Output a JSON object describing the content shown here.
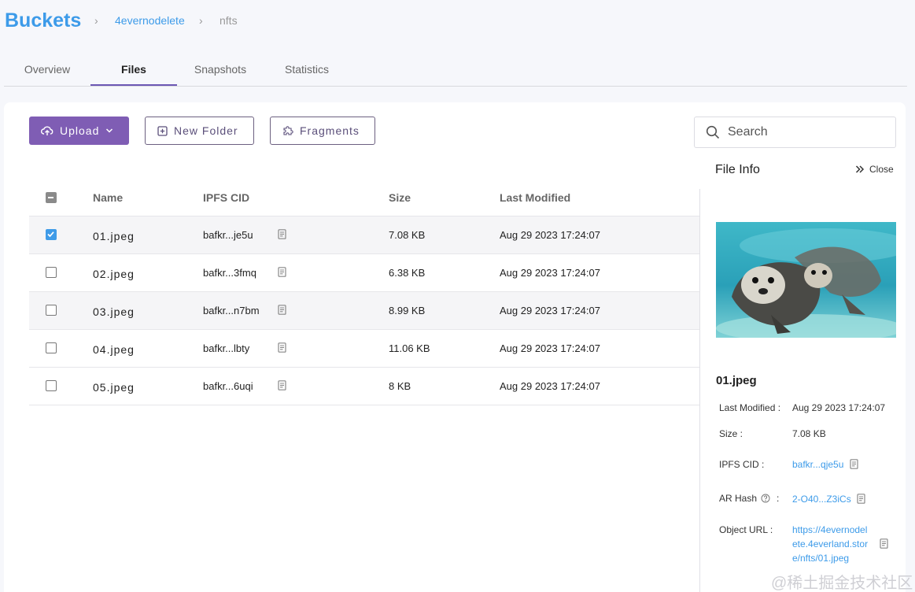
{
  "breadcrumb": {
    "title": "Buckets",
    "bucket": "4evernodelete",
    "folder": "nfts"
  },
  "tabs": [
    {
      "label": "Overview"
    },
    {
      "label": "Files"
    },
    {
      "label": "Snapshots"
    },
    {
      "label": "Statistics"
    }
  ],
  "toolbar": {
    "upload_label": "Upload",
    "new_folder_label": "New Folder",
    "fragments_label": "Fragments",
    "search_placeholder": "Search"
  },
  "table": {
    "headers": {
      "name": "Name",
      "cid": "IPFS CID",
      "size": "Size",
      "modified": "Last Modified"
    },
    "rows": [
      {
        "name": "01.jpeg",
        "cid": "bafkr...je5u",
        "size": "7.08 KB",
        "modified": "Aug 29 2023 17:24:07",
        "checked": true
      },
      {
        "name": "02.jpeg",
        "cid": "bafkr...3fmq",
        "size": "6.38 KB",
        "modified": "Aug 29 2023 17:24:07",
        "checked": false
      },
      {
        "name": "03.jpeg",
        "cid": "bafkr...n7bm",
        "size": "8.99 KB",
        "modified": "Aug 29 2023 17:24:07",
        "checked": false
      },
      {
        "name": "04.jpeg",
        "cid": "bafkr...lbty",
        "size": "11.06 KB",
        "modified": "Aug 29 2023 17:24:07",
        "checked": false
      },
      {
        "name": "05.jpeg",
        "cid": "bafkr...6uqi",
        "size": "8 KB",
        "modified": "Aug 29 2023 17:24:07",
        "checked": false
      }
    ]
  },
  "file_info": {
    "title": "File Info",
    "close_label": "Close",
    "name": "01.jpeg",
    "last_modified_label": "Last Modified :",
    "last_modified": "Aug 29 2023 17:24:07",
    "size_label": "Size :",
    "size": "7.08 KB",
    "cid_label": "IPFS CID :",
    "cid": "bafkr...qje5u",
    "ar_hash_label": "AR Hash",
    "ar_hash_colon": ":",
    "ar_hash": "2-O40...Z3iCs",
    "object_url_label": "Object URL :",
    "object_url_lines": [
      "https://4evernodel",
      "ete.4everland.stor",
      "e/nfts/01.jpeg"
    ]
  },
  "watermark": "@稀土掘金技术社区",
  "colors": {
    "accent": "#7f5db4",
    "link": "#3d9be9",
    "checkbox": "#3f9be8"
  }
}
